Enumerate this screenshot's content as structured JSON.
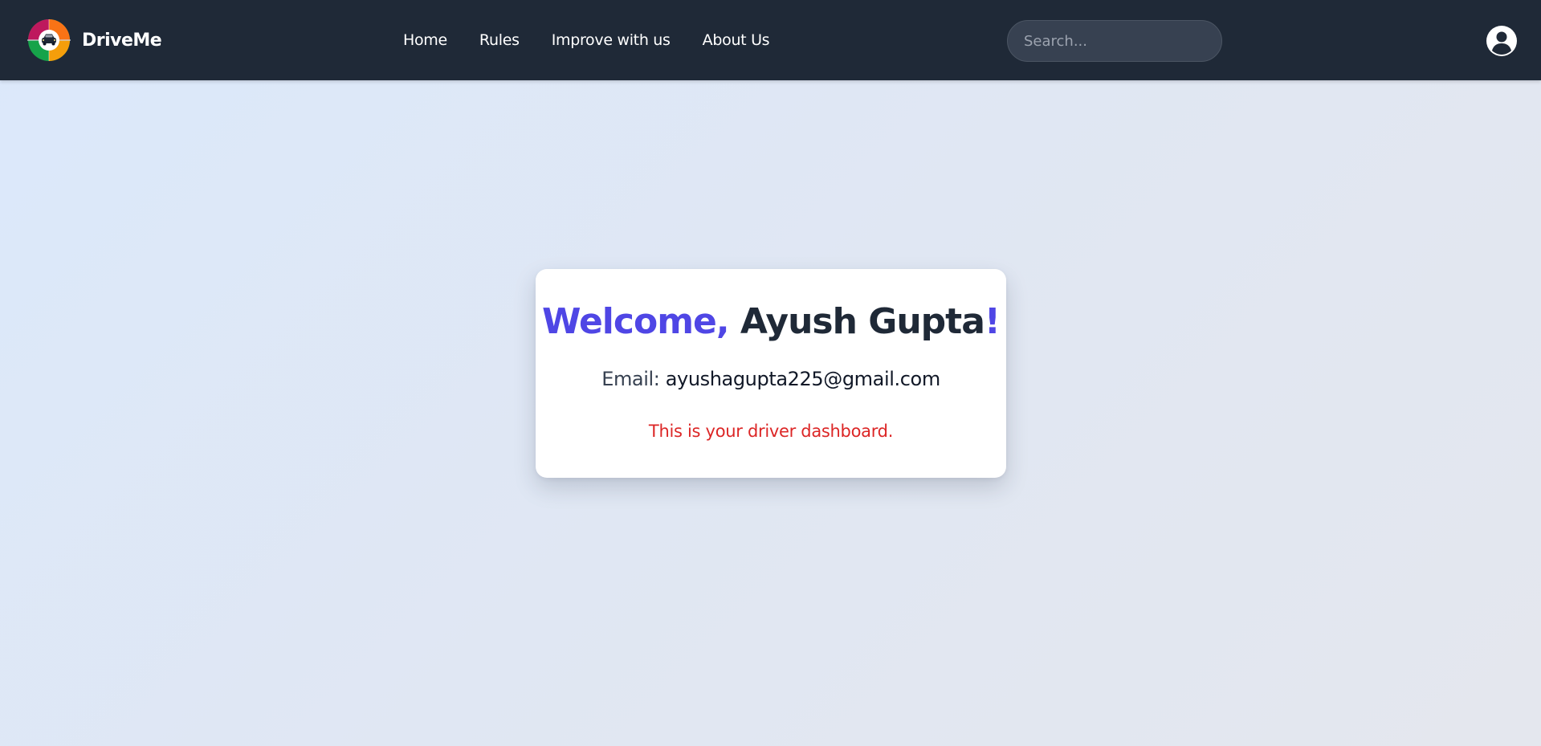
{
  "navbar": {
    "brand_name": "DriveMe",
    "links": [
      {
        "label": "Home"
      },
      {
        "label": "Rules"
      },
      {
        "label": "Improve with us"
      },
      {
        "label": "About Us"
      }
    ],
    "search_placeholder": "Search...",
    "account_icon": "user-circle-icon"
  },
  "card": {
    "welcome_prefix": "Welcome, ",
    "user_name": "Ayush Gupta",
    "welcome_suffix": "!",
    "email_label": "Email: ",
    "email_value": "ayushagupta225@gmail.com",
    "dashboard_message": "This is your driver dashboard."
  },
  "colors": {
    "navbar_bg": "#1f2937",
    "accent": "#4f46e5",
    "message_red": "#dc2626",
    "logo_segments": [
      "#f97316",
      "#f59e0b",
      "#16a34a",
      "#be185d"
    ]
  }
}
